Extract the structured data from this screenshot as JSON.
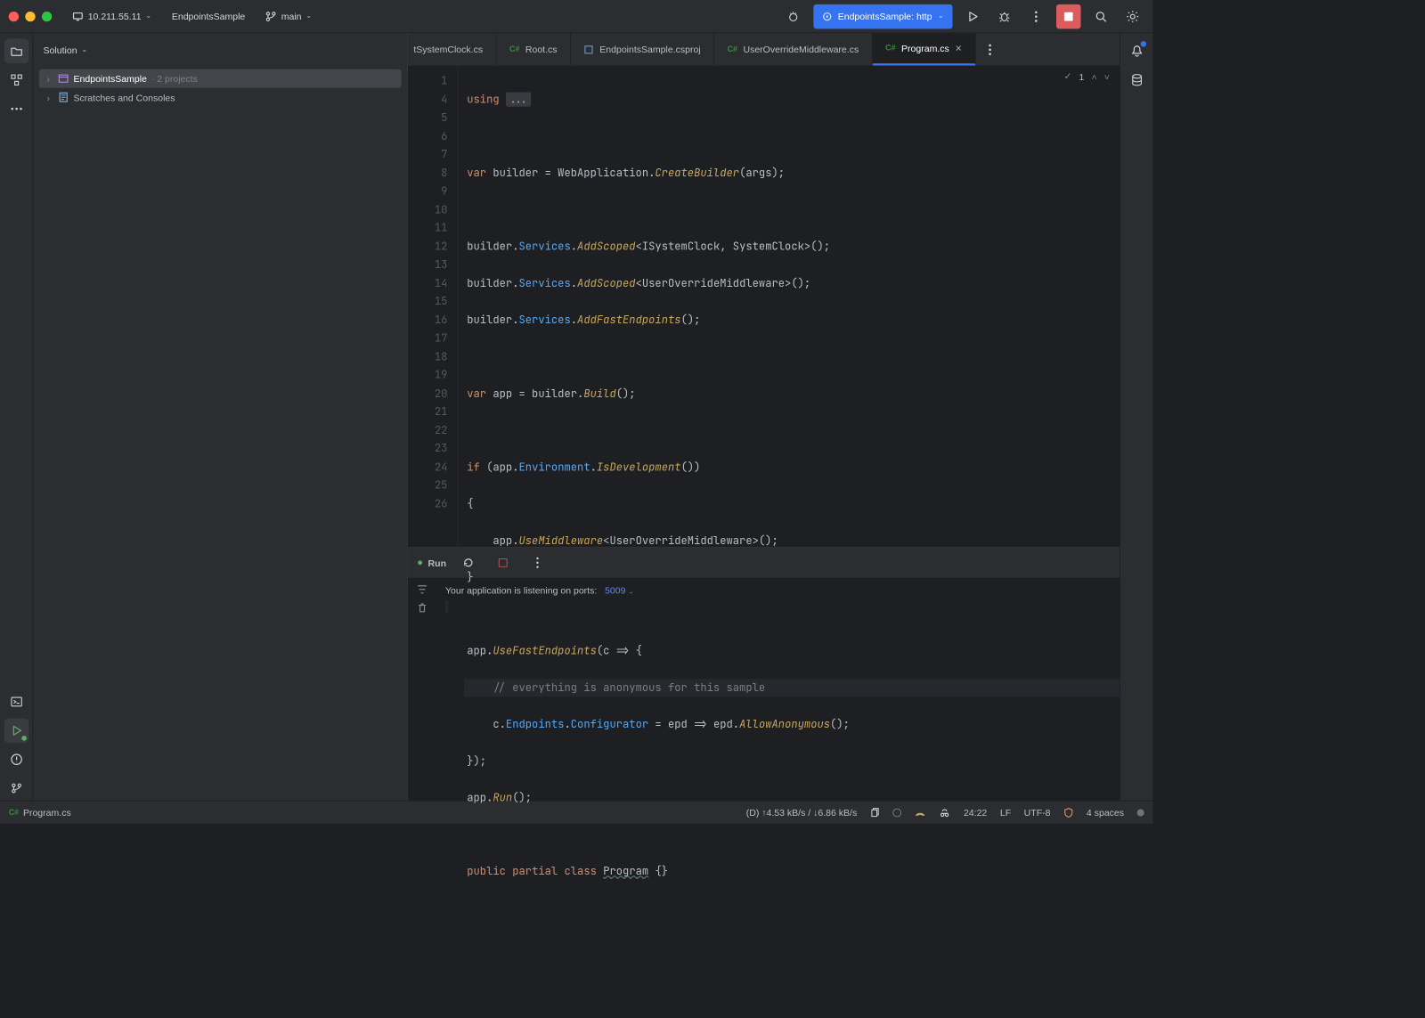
{
  "titlebar": {
    "host": "10.211.55.11",
    "project": "EndpointsSample",
    "branch": "main",
    "run_config": "EndpointsSample: http"
  },
  "sidebar": {
    "title": "Solution",
    "rows": [
      {
        "name": "EndpointsSample",
        "suffix": "· 2 projects"
      },
      {
        "name": "Scratches and Consoles"
      }
    ]
  },
  "tabs": [
    {
      "label": "tSystemClock.cs",
      "kind": "cs",
      "truncated": true
    },
    {
      "label": "Root.cs",
      "kind": "cs"
    },
    {
      "label": "EndpointsSample.csproj",
      "kind": "proj"
    },
    {
      "label": "UserOverrideMiddleware.cs",
      "kind": "cs"
    },
    {
      "label": "Program.cs",
      "kind": "cs",
      "active": true
    }
  ],
  "editor": {
    "problems_count": "1",
    "lines": [
      1,
      4,
      5,
      6,
      7,
      8,
      9,
      10,
      11,
      12,
      13,
      14,
      15,
      16,
      17,
      18,
      19,
      20,
      21,
      22,
      23,
      24,
      25,
      26
    ],
    "highlight_line": 19,
    "code": {
      "l1_using": "using ",
      "l1_fold": "...",
      "l5_var": "var",
      "l5_builder": " builder = WebApplication.",
      "l5_create": "CreateBuilder",
      "l5_tail": "(args);",
      "l7_pre": "builder.",
      "l7_svc": "Services",
      "l7_dot": ".",
      "l7_add": "AddScoped",
      "l7_tail": "<ISystemClock, SystemClock>();",
      "l8_pre": "builder.",
      "l8_svc": "Services",
      "l8_dot": ".",
      "l8_add": "AddScoped",
      "l8_tail": "<UserOverrideMiddleware>();",
      "l9_pre": "builder.",
      "l9_svc": "Services",
      "l9_dot": ".",
      "l9_add": "AddFastEndpoints",
      "l9_tail": "();",
      "l11_var": "var",
      "l11_mid": " app = builder.",
      "l11_build": "Build",
      "l11_tail": "();",
      "l13_if": "if",
      "l13_mid": " (app.",
      "l13_env": "Environment",
      "l13_dot": ".",
      "l13_isdev": "IsDevelopment",
      "l13_tail": "())",
      "l14": "{",
      "l15_ind": "    app.",
      "l15_mw": "UseMiddleware",
      "l15_tail": "<UserOverrideMiddleware>();",
      "l16": "}",
      "l18_pre": "app.",
      "l18_ufe": "UseFastEndpoints",
      "l18_tail": "(c => {",
      "l19_comment": "    // everything is anonymous for this sample",
      "l20_ind": "    c.",
      "l20_ep": "Endpoints",
      "l20_dot": ".",
      "l20_conf": "Configurator",
      "l20_mid": " = epd => epd.",
      "l20_allow": "AllowAnonymous",
      "l20_tail": "();",
      "l21": "});",
      "l22_pre": "app.",
      "l22_run": "Run",
      "l22_tail": "();",
      "l24_public": "public",
      "l24_sp1": " ",
      "l24_partial": "partial",
      "l24_sp2": " ",
      "l24_class": "class",
      "l24_sp3": " ",
      "l24_prog": "Program",
      "l24_tail": " {}"
    }
  },
  "run": {
    "title": "Run",
    "listening": "Your application is listening on ports:",
    "port": "5009"
  },
  "status": {
    "file": "Program.cs",
    "net": "(D) ↑4.53 kB/s / ↓6.86 kB/s",
    "pos": "24:22",
    "eol": "LF",
    "enc": "UTF-8",
    "indent": "4 spaces"
  }
}
